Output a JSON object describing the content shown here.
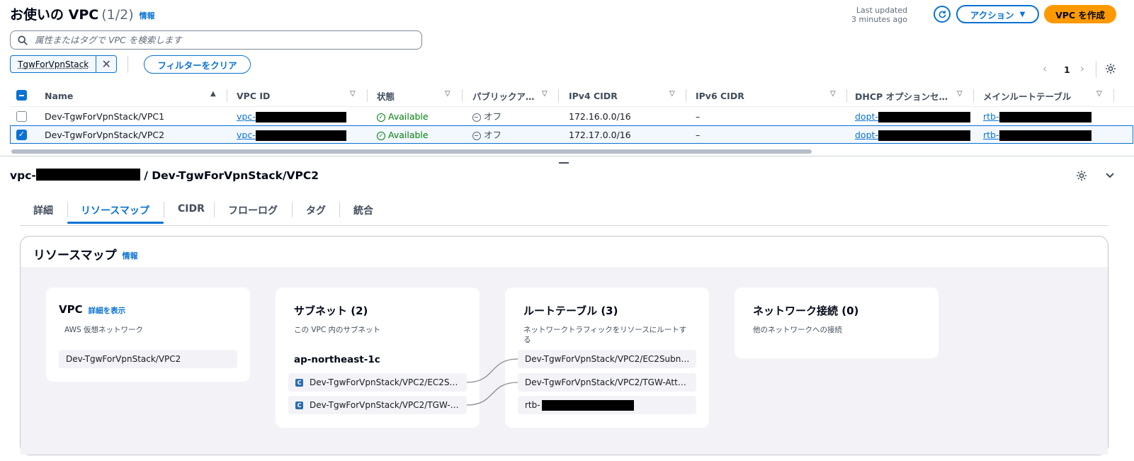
{
  "header": {
    "title": "お使いの VPC",
    "count": "(1/2)",
    "info": "情報",
    "last_updated_line1": "Last updated",
    "last_updated_line2": "3 minutes ago",
    "actions_label": "アクション",
    "create_label": "VPC を作成"
  },
  "search": {
    "placeholder": "属性またはタグで VPC を検索します"
  },
  "filter": {
    "token": "TgwForVpnStack",
    "clear_label": "フィルターをクリア"
  },
  "pagination": {
    "page": "1"
  },
  "table": {
    "columns": [
      "Name",
      "VPC ID",
      "状態",
      "パブリックア…",
      "IPv4 CIDR",
      "IPv6 CIDR",
      "DHCP オプションセ…",
      "メインルートテーブル"
    ],
    "rows": [
      {
        "name": "Dev-TgwForVpnStack/VPC1",
        "vpc_id": "vpc-",
        "state": "Available",
        "public": "オフ",
        "ipv4": "172.16.0.0/16",
        "ipv6": "–",
        "dhcp": "dopt-",
        "rtb": "rtb-",
        "selected": false
      },
      {
        "name": "Dev-TgwForVpnStack/VPC2",
        "vpc_id": "vpc-",
        "state": "Available",
        "public": "オフ",
        "ipv4": "172.17.0.0/16",
        "ipv6": "–",
        "dhcp": "dopt-",
        "rtb": "rtb-",
        "selected": true
      }
    ]
  },
  "detail": {
    "title_prefix": "vpc-",
    "title_suffix": "/ Dev-TgwForVpnStack/VPC2",
    "tabs": [
      "詳細",
      "リソースマップ",
      "CIDR",
      "フローログ",
      "タグ",
      "統合"
    ],
    "active_tab": 1
  },
  "resource_map": {
    "heading": "リソースマップ",
    "info": "情報",
    "vpc": {
      "title": "VPC",
      "link": "詳細を表示",
      "sub": "AWS 仮想ネットワーク",
      "item": "Dev-TgwForVpnStack/VPC2"
    },
    "subnets": {
      "title": "サブネット (2)",
      "sub": "この VPC 内のサブネット",
      "az": "ap-northeast-1c",
      "items": [
        "Dev-TgwForVpnStack/VPC2/EC2S…",
        "Dev-TgwForVpnStack/VPC2/TGW-…"
      ]
    },
    "route_tables": {
      "title": "ルートテーブル (3)",
      "sub_line1": "ネットワークトラフィックをリソースにルートす",
      "sub_line2": "る",
      "items": [
        "Dev-TgwForVpnStack/VPC2/EC2Subn…",
        "Dev-TgwForVpnStack/VPC2/TGW-Att…",
        "rtb-"
      ]
    },
    "network": {
      "title": "ネットワーク接続 (0)",
      "sub": "他のネットワークへの接続"
    }
  },
  "colors": {
    "accent": "#0972d3",
    "primary_button": "#ff9900",
    "success": "#037f0c"
  },
  "icons": [
    "search-icon",
    "refresh-icon",
    "caret-down-icon",
    "close-icon",
    "chevron-left-icon",
    "chevron-right-icon",
    "gear-icon",
    "sort-asc-icon",
    "check-circle-icon",
    "minus-circle-icon",
    "chevron-down-icon",
    "subnet-icon"
  ]
}
